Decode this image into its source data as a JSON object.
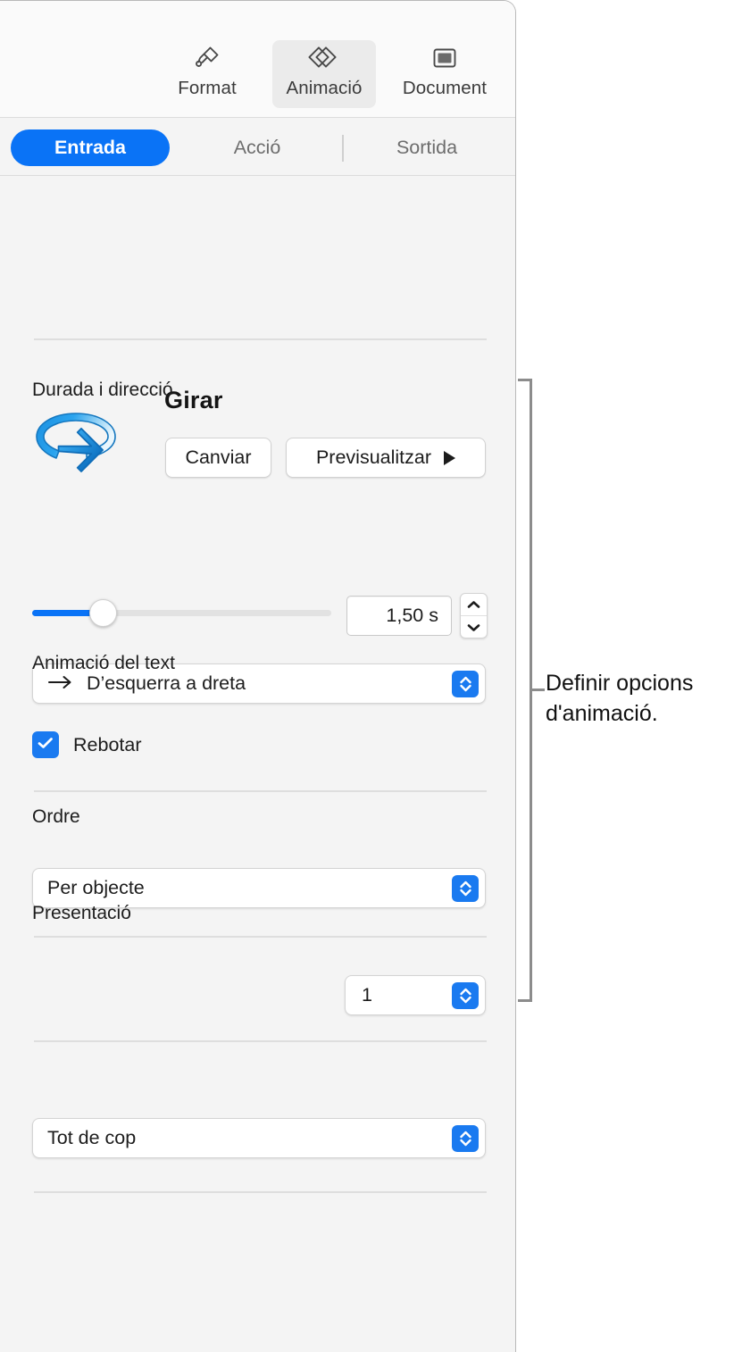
{
  "toolbar": {
    "items": [
      {
        "label": "Format",
        "icon": "paintbrush-icon",
        "selected": false
      },
      {
        "label": "Animació",
        "icon": "animation-diamonds-icon",
        "selected": true
      },
      {
        "label": "Document",
        "icon": "document-icon",
        "selected": false
      }
    ]
  },
  "tabs": [
    {
      "label": "Entrada",
      "active": true
    },
    {
      "label": "Acció",
      "active": false
    },
    {
      "label": "Sortida",
      "active": false
    }
  ],
  "effect": {
    "icon": "rotate-3d-arrow-icon",
    "name": "Girar",
    "change_label": "Canviar",
    "preview_label": "Previsualitzar",
    "preview_icon": "play-triangle-icon"
  },
  "duration": {
    "section_label": "Durada i direcció",
    "slider_percent": 20,
    "value": "1,50 s",
    "stepper_icon": "stepper-up-down-icon"
  },
  "direction": {
    "arrow_icon": "arrow-right-icon",
    "value": "D’esquerra a dreta",
    "chevron_icon": "chevron-up-down-icon"
  },
  "bounce": {
    "label": "Rebotar",
    "checked": true,
    "check_icon": "checkmark-icon"
  },
  "text_animation": {
    "section_label": "Animació del text",
    "value": "Per objecte",
    "chevron_icon": "chevron-up-down-icon"
  },
  "order": {
    "label": "Ordre",
    "value": "1",
    "chevron_icon": "chevron-up-down-icon"
  },
  "delivery": {
    "section_label": "Presentació",
    "value": "Tot de cop",
    "chevron_icon": "chevron-up-down-icon"
  },
  "callout": {
    "text": "Definir opcions d'animació."
  },
  "colors": {
    "accent_blue": "#0a73f6",
    "control_blue": "#1a7af0",
    "panel_bg": "#f4f4f4",
    "toolbar_bg": "#fafafa",
    "callout_gray": "#8c8c8c"
  }
}
